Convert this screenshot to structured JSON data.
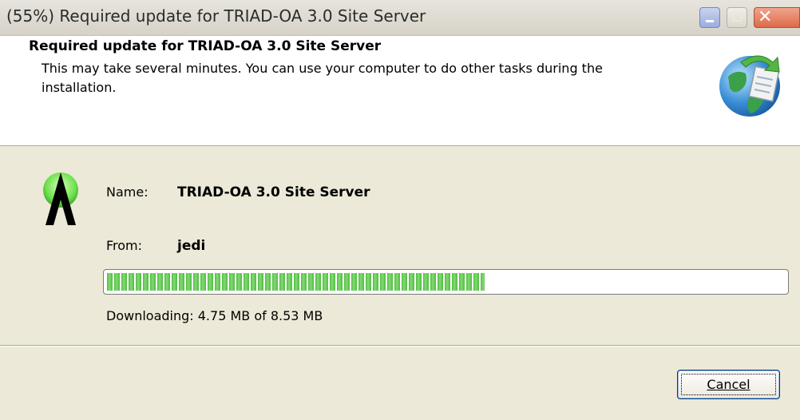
{
  "window": {
    "title": "(55%) Required update for TRIAD-OA 3.0 Site Server",
    "controls": {
      "minimize": "minimize",
      "maximize": "maximize",
      "close": "close"
    }
  },
  "header": {
    "title": "Required update for TRIAD-OA 3.0 Site Server",
    "description": "This may take several minutes. You can use your computer to do other tasks during the installation.",
    "icon": "globe-update-icon"
  },
  "details": {
    "app_icon": "app-logo-icon",
    "name_label": "Name:",
    "name_value": "TRIAD-OA 3.0 Site Server",
    "from_label": "From:",
    "from_value": "jedi"
  },
  "progress": {
    "fraction": 0.557,
    "status": "Downloading: 4.75 MB of 8.53 MB"
  },
  "buttons": {
    "cancel_label": "Cancel"
  },
  "colors": {
    "progress_fill": "#4cbf3c",
    "dialog_bg": "#ece9d8",
    "accent_close": "#de6a4a"
  }
}
